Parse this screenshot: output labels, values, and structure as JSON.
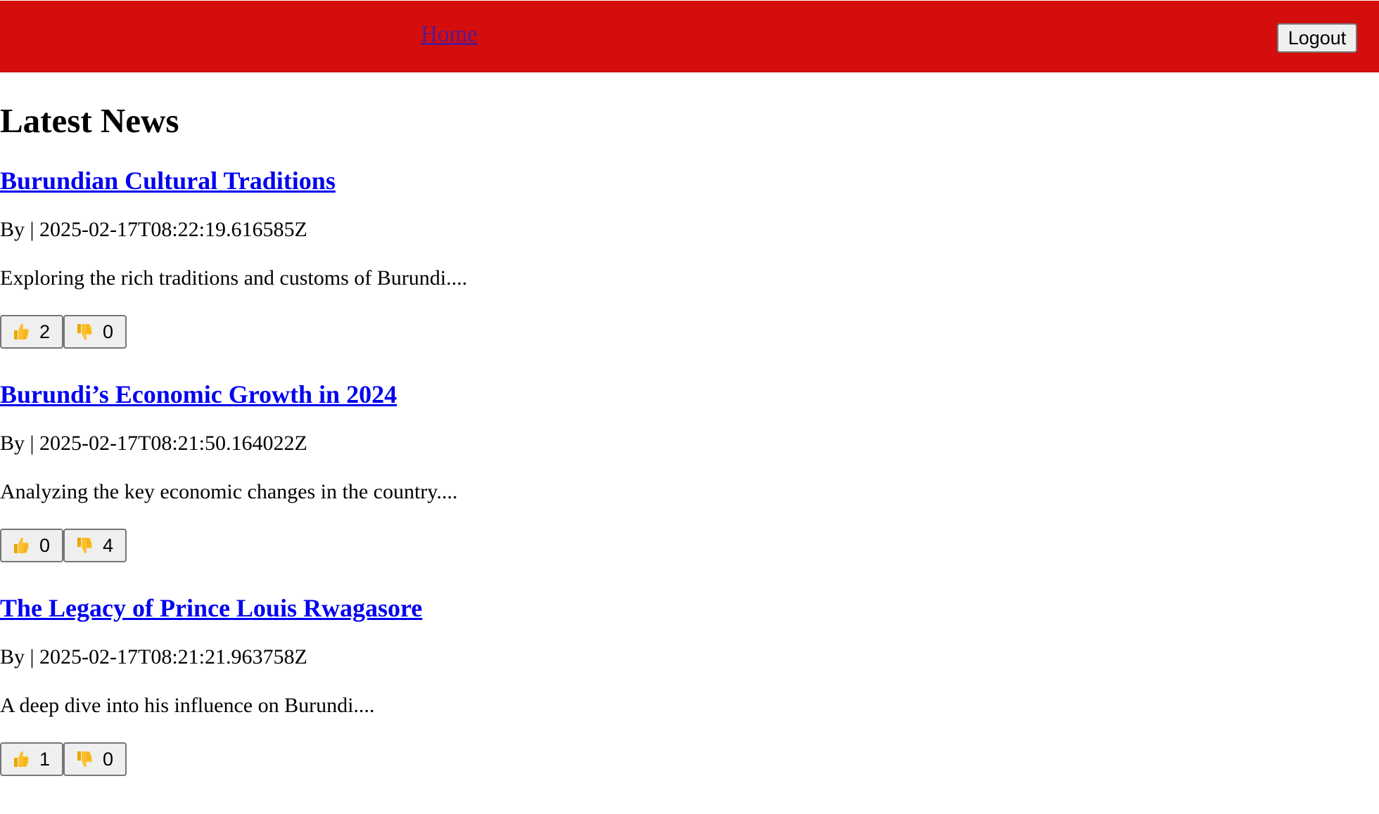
{
  "nav": {
    "home_label": "Home",
    "logout_label": "Logout",
    "header_color": "#d40d0d"
  },
  "main": {
    "title": "Latest News",
    "articles": [
      {
        "title": "Burundian Cultural Traditions",
        "meta": "By | 2025-02-17T08:22:19.616585Z",
        "excerpt": "Exploring the rich traditions and customs of Burundi....",
        "likes": "2",
        "dislikes": "0"
      },
      {
        "title": "Burundi’s Economic Growth in 2024",
        "meta": "By | 2025-02-17T08:21:50.164022Z",
        "excerpt": "Analyzing the key economic changes in the country....",
        "likes": "0",
        "dislikes": "4"
      },
      {
        "title": "The Legacy of Prince Louis Rwagasore",
        "meta": "By | 2025-02-17T08:21:21.963758Z",
        "excerpt": "A deep dive into his influence on Burundi....",
        "likes": "1",
        "dislikes": "0"
      }
    ]
  },
  "icons": {
    "like": "thumbs-up-icon",
    "dislike": "thumbs-down-icon"
  }
}
